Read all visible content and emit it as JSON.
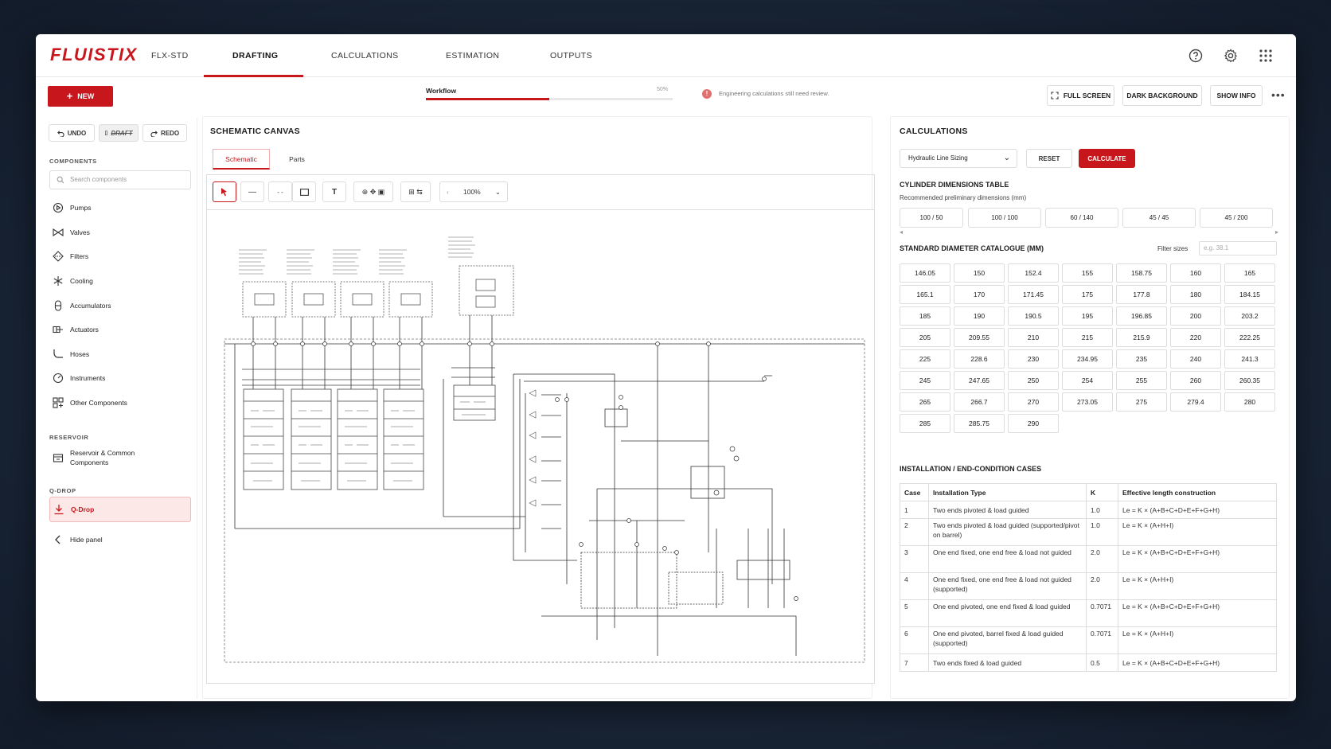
{
  "app": {
    "logo": "FLUISTIX",
    "project_code": "FLX-STD"
  },
  "nav": {
    "tabs": [
      "DRAFTING",
      "CALCULATIONS",
      "ESTIMATION",
      "OUTPUTS"
    ],
    "active": "DRAFTING"
  },
  "top_icons": [
    "help-icon",
    "gear-icon",
    "apps-grid-icon"
  ],
  "toolbar": {
    "new_label": "NEW",
    "workflow_label": "Workflow",
    "workflow_pct_label": "50%",
    "workflow_progress": 0.5,
    "warning_text": "Engineering calculations still need review.",
    "full_screen": "FULL SCREEN",
    "dark_background": "DARK BACKGROUND",
    "show_info": "SHOW INFO"
  },
  "left": {
    "undo": "UNDO",
    "middle_btn": "DRAFT",
    "redo": "REDO",
    "components_header": "COMPONENTS",
    "search_placeholder": "Search components",
    "components": [
      {
        "label": "Pumps",
        "icon": "pump-icon"
      },
      {
        "label": "Valves",
        "icon": "valve-icon"
      },
      {
        "label": "Filters",
        "icon": "filter-icon"
      },
      {
        "label": "Cooling",
        "icon": "cooling-icon"
      },
      {
        "label": "Accumulators",
        "icon": "accumulator-icon"
      },
      {
        "label": "Actuators",
        "icon": "actuator-icon"
      },
      {
        "label": "Hoses",
        "icon": "hose-icon"
      },
      {
        "label": "Instruments",
        "icon": "gauge-icon"
      },
      {
        "label": "Other Components",
        "icon": "grid-icon"
      }
    ],
    "reservoir_header": "RESERVOIR",
    "reservoir_item_line1": "Reservoir & Common",
    "reservoir_item_line2": "Components",
    "qdrop_header": "Q-DROP",
    "qdrop_item": "Q-Drop",
    "hide_panel": "Hide panel"
  },
  "canvas": {
    "title": "SCHEMATIC CANVAS",
    "tabs": [
      "Schematic",
      "Parts"
    ],
    "zoom": "100%"
  },
  "calc": {
    "title": "CALCULATIONS",
    "selected_calc": "Hydraulic Line Sizing",
    "reset": "RESET",
    "calculate": "CALCULATE",
    "cyl_title": "CYLINDER DIMENSIONS TABLE",
    "cyl_sub": "Recommended preliminary dimensions (mm)",
    "cyl_dims": [
      "100 / 50",
      "100 / 100",
      "60 / 140",
      "45 / 45",
      "45 / 200"
    ],
    "std_title": "STANDARD DIAMETER CATALOGUE (MM)",
    "filter_label": "Filter sizes",
    "filter_placeholder": "e.g. 38.1",
    "diameters": [
      "146.05",
      "150",
      "152.4",
      "155",
      "158.75",
      "160",
      "165",
      "165.1",
      "170",
      "171.45",
      "175",
      "177.8",
      "180",
      "184.15",
      "185",
      "190",
      "190.5",
      "195",
      "196.85",
      "200",
      "203.2",
      "205",
      "209.55",
      "210",
      "215",
      "215.9",
      "220",
      "222.25",
      "225",
      "228.6",
      "230",
      "234.95",
      "235",
      "240",
      "241.3",
      "245",
      "247.65",
      "250",
      "254",
      "255",
      "260",
      "260.35",
      "265",
      "266.7",
      "270",
      "273.05",
      "275",
      "279.4",
      "280",
      "285",
      "285.75",
      "290"
    ],
    "install_title": "INSTALLATION / END-CONDITION CASES",
    "install_headers": [
      "Case",
      "Installation Type",
      "K",
      "Effective length construction"
    ],
    "install_rows": [
      [
        "1",
        "Two ends pivoted & load guided",
        "1.0",
        "Le = K × (A+B+C+D+E+F+G+H)"
      ],
      [
        "2",
        "Two ends pivoted & load guided (supported/pivot on barrel)",
        "1.0",
        "Le = K × (A+H+I)"
      ],
      [
        "3",
        "One end fixed, one end free & load not guided",
        "2.0",
        "Le = K × (A+B+C+D+E+F+G+H)"
      ],
      [
        "4",
        "One end fixed, one end free & load not guided (supported)",
        "2.0",
        "Le = K × (A+H+I)"
      ],
      [
        "5",
        "One end pivoted, one end fixed & load guided",
        "0.7071",
        "Le = K × (A+B+C+D+E+F+G+H)"
      ],
      [
        "6",
        "One end pivoted, barrel fixed & load guided (supported)",
        "0.7071",
        "Le = K × (A+H+I)"
      ],
      [
        "7",
        "Two ends fixed & load guided",
        "0.5",
        "Le = K × (A+B+C+D+E+F+G+H)"
      ]
    ]
  },
  "colors": {
    "accent": "#c8161d",
    "background": "#1a2638"
  }
}
